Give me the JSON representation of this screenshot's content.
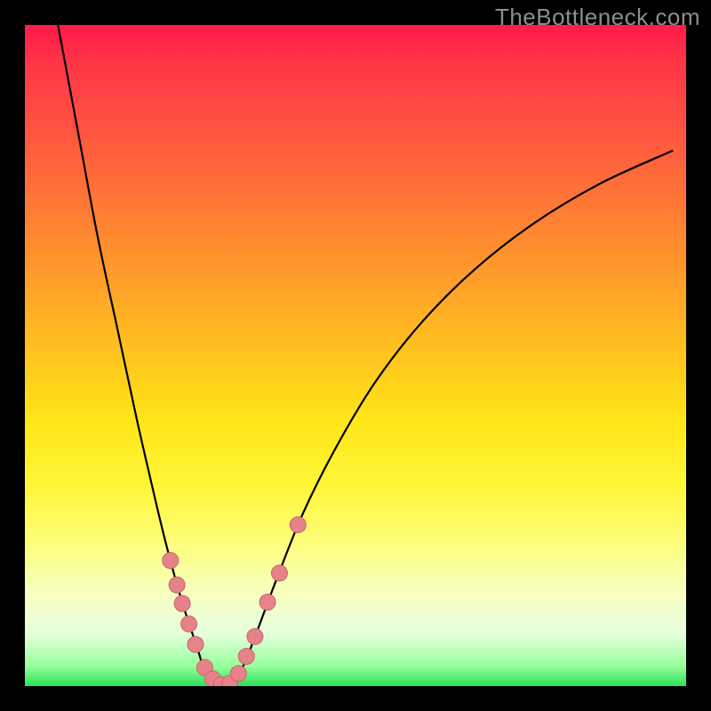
{
  "watermark": "TheBottleneck.com",
  "colors": {
    "background": "#000000",
    "dot_fill": "#e68289",
    "dot_stroke": "#c9646d",
    "curve": "#000000"
  },
  "chart_data": {
    "type": "line",
    "title": "",
    "xlabel": "",
    "ylabel": "",
    "xlim": [
      0,
      100
    ],
    "ylim": [
      0,
      100
    ],
    "background_gradient": [
      {
        "pos": 0,
        "color": "#ff1a4a"
      },
      {
        "pos": 50,
        "color": "#ffc41e"
      },
      {
        "pos": 80,
        "color": "#fcff80"
      },
      {
        "pos": 100,
        "color": "#2be05a"
      }
    ],
    "series": [
      {
        "name": "bottleneck-curve",
        "x": [
          5,
          8,
          11,
          14,
          17,
          20,
          22,
          24,
          26,
          27,
          28.5,
          30,
          31.5,
          33,
          35,
          38,
          42,
          47,
          53,
          60,
          68,
          77,
          87,
          98
        ],
        "y": [
          100,
          84,
          68,
          54,
          40,
          27,
          19,
          12,
          6,
          3,
          1,
          0,
          1,
          3,
          8,
          16,
          26,
          36,
          46,
          55,
          63,
          70,
          76,
          81
        ]
      }
    ],
    "markers": [
      {
        "x": 22.0,
        "y": 19.0
      },
      {
        "x": 23.0,
        "y": 15.3
      },
      {
        "x": 23.8,
        "y": 12.5
      },
      {
        "x": 24.8,
        "y": 9.4
      },
      {
        "x": 25.8,
        "y": 6.3
      },
      {
        "x": 27.2,
        "y": 2.8
      },
      {
        "x": 28.4,
        "y": 1.1
      },
      {
        "x": 29.7,
        "y": 0.2
      },
      {
        "x": 31.0,
        "y": 0.4
      },
      {
        "x": 32.3,
        "y": 1.9
      },
      {
        "x": 33.5,
        "y": 4.5
      },
      {
        "x": 34.8,
        "y": 7.5
      },
      {
        "x": 36.7,
        "y": 12.7
      },
      {
        "x": 38.5,
        "y": 17.1
      },
      {
        "x": 41.3,
        "y": 24.4
      }
    ]
  }
}
